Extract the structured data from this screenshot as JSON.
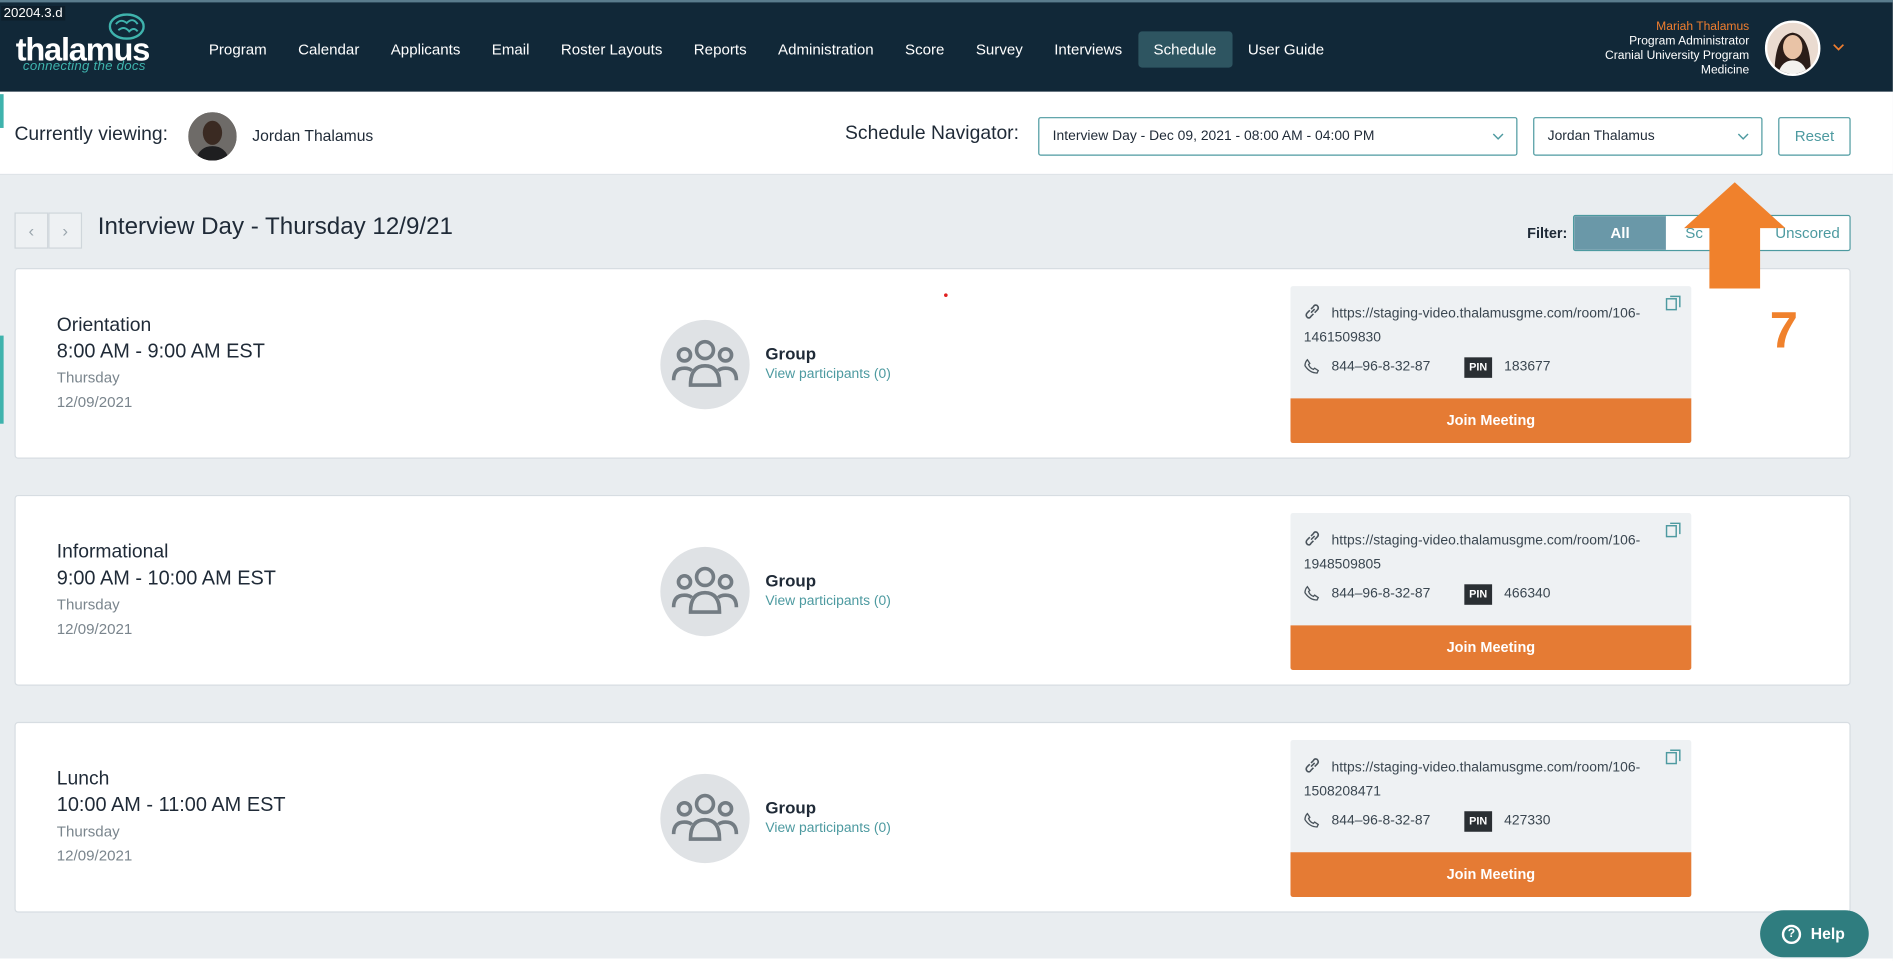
{
  "build_tag": "20204.3.d",
  "brand": {
    "name": "thalamus",
    "tagline": "connecting the docs"
  },
  "nav": {
    "items": [
      "Program",
      "Calendar",
      "Applicants",
      "Email",
      "Roster Layouts",
      "Reports",
      "Administration",
      "Score",
      "Survey",
      "Interviews",
      "Schedule",
      "User Guide"
    ],
    "active": "Schedule"
  },
  "user": {
    "name": "Mariah Thalamus",
    "role": "Program Administrator",
    "program_line1": "Cranial University Program",
    "program_line2": "Medicine"
  },
  "viewing": {
    "label": "Currently viewing:",
    "name": "Jordan Thalamus"
  },
  "schedule_navigator": {
    "label": "Schedule Navigator:",
    "day_value": "Interview Day - Dec 09, 2021 - 08:00 AM - 04:00 PM",
    "person_value": "Jordan Thalamus",
    "reset_label": "Reset"
  },
  "day": {
    "title": "Interview Day - Thursday 12/9/21",
    "prev": "‹",
    "next": "›"
  },
  "filter": {
    "label": "Filter:",
    "options": [
      "All",
      "Sc",
      "Unscored"
    ],
    "active": "All"
  },
  "events": [
    {
      "title": "Orientation",
      "time": "8:00 AM - 9:00 AM EST",
      "weekday": "Thursday",
      "date": "12/09/2021",
      "group_label": "Group",
      "participants": "View participants (0)",
      "url": "https://staging-video.thalamusgme.com/room/106-1461509830",
      "phone": "844–96-8-32-87",
      "pin_label": "PIN",
      "pin": "183677",
      "join_label": "Join Meeting"
    },
    {
      "title": "Informational",
      "time": "9:00 AM - 10:00 AM EST",
      "weekday": "Thursday",
      "date": "12/09/2021",
      "group_label": "Group",
      "participants": "View participants (0)",
      "url": "https://staging-video.thalamusgme.com/room/106-1948509805",
      "phone": "844–96-8-32-87",
      "pin_label": "PIN",
      "pin": "466340",
      "join_label": "Join Meeting"
    },
    {
      "title": "Lunch",
      "time": "10:00 AM - 11:00 AM EST",
      "weekday": "Thursday",
      "date": "12/09/2021",
      "group_label": "Group",
      "participants": "View participants (0)",
      "url": "https://staging-video.thalamusgme.com/room/106-1508208471",
      "phone": "844–96-8-32-87",
      "pin_label": "PIN",
      "pin": "427330",
      "join_label": "Join Meeting"
    }
  ],
  "annotation": {
    "number": "7",
    "color": "#f0812c"
  },
  "help": {
    "label": "Help"
  },
  "colors": {
    "nav_bg": "#112838",
    "accent_teal": "#4d9aa0",
    "join_orange": "#e57b34",
    "user_name": "#f07e2f"
  }
}
